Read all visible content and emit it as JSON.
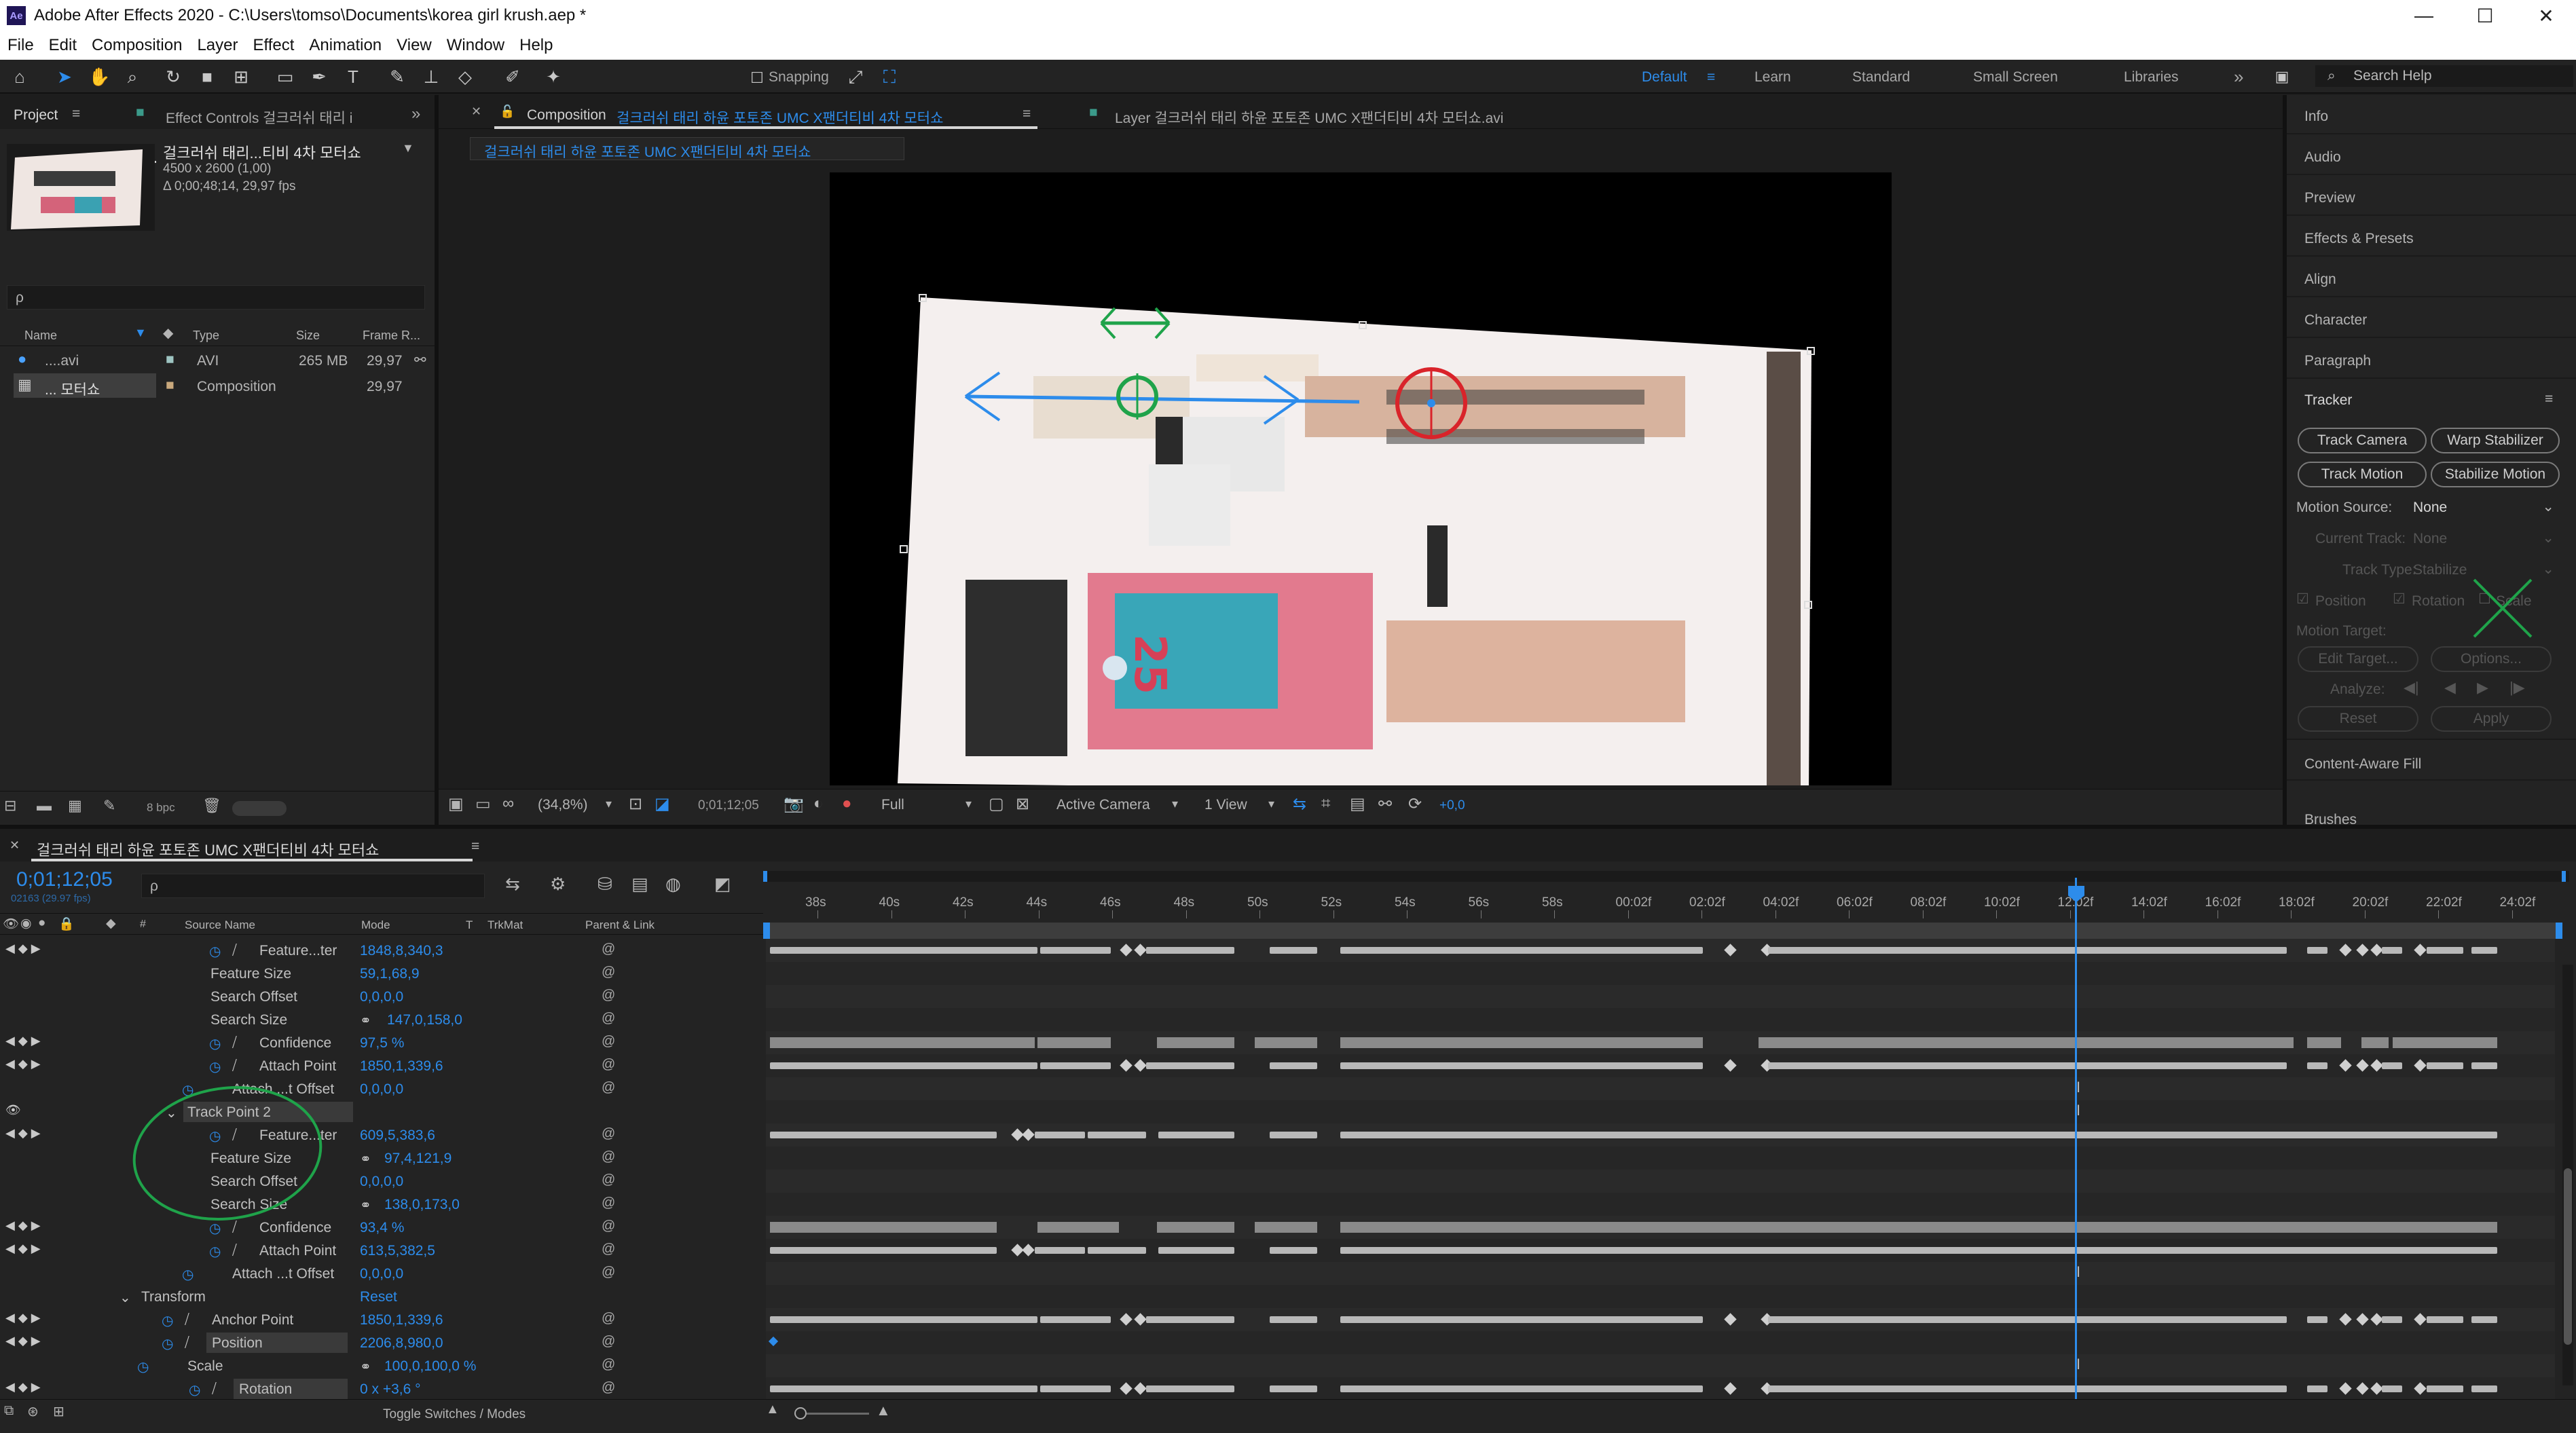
{
  "app": {
    "title": "Adobe After Effects 2020 - C:\\Users\\tomso\\Documents\\korea girl krush.aep *",
    "icon_text": "Ae",
    "window_controls": [
      "—",
      "☐",
      "✕"
    ]
  },
  "menu": [
    "File",
    "Edit",
    "Composition",
    "Layer",
    "Effect",
    "Animation",
    "View",
    "Window",
    "Help"
  ],
  "toolbar": {
    "snapping_label": "Snapping",
    "workspaces": [
      "Default",
      "Learn",
      "Standard",
      "Small Screen",
      "Libraries"
    ],
    "overflow": "»",
    "search_help": "Search Help"
  },
  "project": {
    "tab_label": "Project",
    "effect_controls_label": "Effect Controls 걸크러쉬 태리 i",
    "comp_name": "걸크러쉬 태리...티비 4차 모터쇼",
    "size": "4500 x 2600 (1,00)",
    "duration": "Δ 0;00;48;14, 29,97 fps",
    "search_placeholder": "ρ",
    "columns": [
      "Name",
      "Type",
      "Size",
      "Frame R..."
    ],
    "items": [
      {
        "name": "....avi",
        "type": "AVI",
        "size": "265 MB",
        "fps": "29,97"
      },
      {
        "name": "... 모터쇼",
        "type": "Composition",
        "size": "",
        "fps": "29,97"
      }
    ],
    "bpc": "8 bpc"
  },
  "comp_panel": {
    "tab_prefix": "Composition",
    "comp_tab_name": "걸크러쉬 태리 하윤 포토존 UMC X팬더티비 4차 모터쇼",
    "layer_tab_label": "Layer 걸크러쉬 태리 하윤 포토존 UMC X팬더티비 4차 모터쇼.avi",
    "breadcrumb": "걸크러쉬 태리 하윤 포토존 UMC X팬더티비 4차 모터쇼",
    "zoom": "(34,8%)",
    "timecode": "0;01;12;05",
    "resolution": "Full",
    "camera": "Active Camera",
    "views": "1 View",
    "exposure": "+0,0"
  },
  "right_panel": {
    "items": [
      "Info",
      "Audio",
      "Preview",
      "Effects & Presets",
      "Align",
      "Character",
      "Paragraph"
    ],
    "tracker": {
      "title": "Tracker",
      "buttons": [
        "Track Camera",
        "Warp Stabilizer",
        "Track Motion",
        "Stabilize Motion"
      ],
      "motion_source_label": "Motion Source:",
      "motion_source_value": "None",
      "current_track_label": "Current Track:",
      "current_track_value": "None",
      "track_type_label": "Track Type:",
      "track_type_value": "Stabilize",
      "checks": [
        "Position",
        "Rotation",
        "Scale"
      ],
      "motion_target_label": "Motion Target:",
      "edit_target": "Edit Target...",
      "options": "Options...",
      "analyze_label": "Analyze:",
      "reset": "Reset",
      "apply": "Apply"
    },
    "content_aware_fill": "Content-Aware Fill",
    "brushes": "Brushes"
  },
  "timeline": {
    "tab_label": "걸크러쉬 태리 하윤 포토존 UMC X팬더티비 4차 모터쇼",
    "current_time": "0;01;12;05",
    "frame_info": "02163 (29.97 fps)",
    "columns": [
      "Source Name",
      "Mode",
      "T",
      "TrkMat",
      "Parent & Link"
    ],
    "ruler_labels": [
      "38s",
      "40s",
      "42s",
      "44s",
      "46s",
      "48s",
      "50s",
      "52s",
      "54s",
      "56s",
      "58s",
      "00:02f",
      "02:02f",
      "04:02f",
      "06:02f",
      "08:02f",
      "10:02f",
      "12:02f",
      "14:02f",
      "16:02f",
      "18:02f",
      "20:02f",
      "22:02f",
      "24:02f"
    ],
    "rows": [
      {
        "label": "Feature...ter",
        "value": "1848,8,340,3"
      },
      {
        "label": "Feature Size",
        "value": "59,1,68,9"
      },
      {
        "label": "Search Offset",
        "value": "0,0,0,0"
      },
      {
        "label": "Search Size",
        "value": "147,0,158,0"
      },
      {
        "label": "Confidence",
        "value": "97,5 %"
      },
      {
        "label": "Attach Point",
        "value": "1850,1,339,6"
      },
      {
        "label": "Attach ...t Offset",
        "value": "0,0,0,0"
      },
      {
        "label": "Track Point 2",
        "value": ""
      },
      {
        "label": "Feature...ter",
        "value": "609,5,383,6"
      },
      {
        "label": "Feature Size",
        "value": "97,4,121,9"
      },
      {
        "label": "Search Offset",
        "value": "0,0,0,0"
      },
      {
        "label": "Search Size",
        "value": "138,0,173,0"
      },
      {
        "label": "Confidence",
        "value": "93,4 %"
      },
      {
        "label": "Attach Point",
        "value": "613,5,382,5"
      },
      {
        "label": "Attach ...t Offset",
        "value": "0,0,0,0"
      },
      {
        "label": "Transform",
        "value": "Reset"
      },
      {
        "label": "Anchor Point",
        "value": "1850,1,339,6"
      },
      {
        "label": "Position",
        "value": "2206,8,980,0"
      },
      {
        "label": "Scale",
        "value": "100,0,100,0 %"
      },
      {
        "label": "Rotation",
        "value": "0 x +3,6 °"
      }
    ],
    "toggle_label": "Toggle Switches / Modes"
  },
  "colors": {
    "accent": "#2d8ceb",
    "panel": "#232323",
    "annotation_green": "#1fa34a",
    "annotation_red": "#d9232a"
  }
}
